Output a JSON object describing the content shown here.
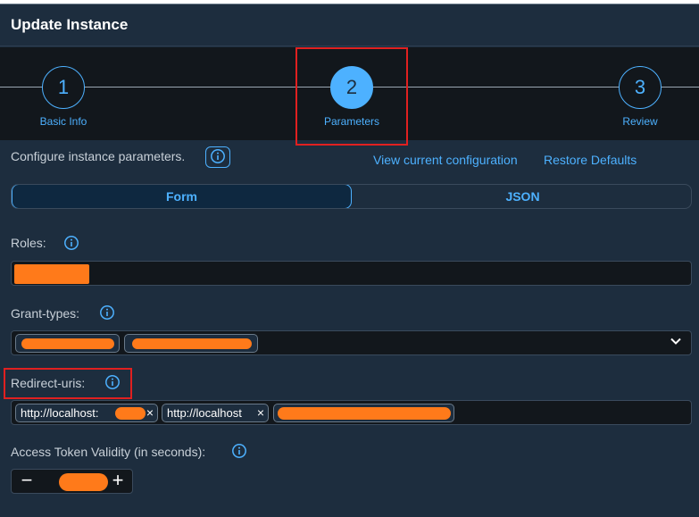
{
  "dialog": {
    "title": "Update Instance"
  },
  "wizard": {
    "steps": [
      {
        "number": "1",
        "label": "Basic Info"
      },
      {
        "number": "2",
        "label": "Parameters"
      },
      {
        "number": "3",
        "label": "Review"
      }
    ]
  },
  "params": {
    "description": "Configure instance parameters.",
    "info_icon": "i",
    "view_config_link": "View current configuration",
    "restore_defaults_link": "Restore Defaults",
    "tabs": [
      {
        "label": "Form"
      },
      {
        "label": "JSON"
      }
    ]
  },
  "fields": {
    "roles": {
      "label": "Roles:"
    },
    "grant_types": {
      "label": "Grant-types:"
    },
    "redirect_uris": {
      "label": "Redirect-uris:",
      "tokens": [
        "http://localhost:",
        "http://localhost"
      ],
      "remove_symbol": "×"
    },
    "access_token_validity": {
      "label": "Access Token Validity (in seconds):",
      "minus": "−",
      "plus": "+"
    }
  },
  "icons": {
    "info": "info-icon",
    "chevron": "chevron-down-icon"
  },
  "colors": {
    "accent": "#4db1ff",
    "highlight": "#e02020",
    "redaction": "#ff7a1a",
    "background": "#1d2d3e"
  }
}
